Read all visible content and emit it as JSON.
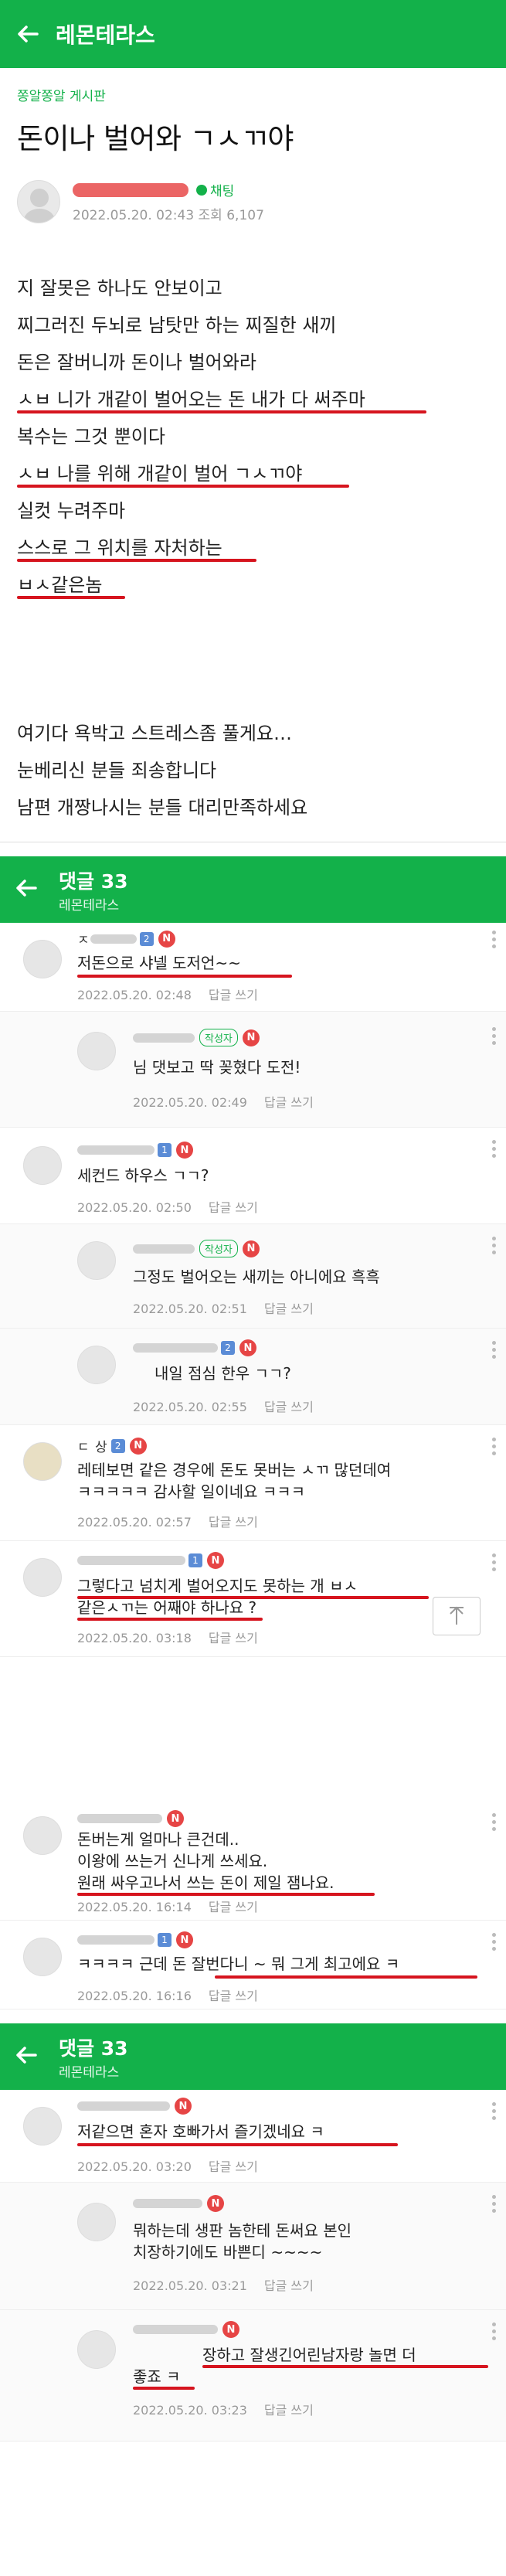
{
  "colors": {
    "brand_green": "#13b14a",
    "underline_red": "#d6141e",
    "new_badge": "#e64545"
  },
  "post": {
    "app_title": "레몬테라스",
    "board_link": "쫑알쫑알 게시판",
    "title": "돈이나 벌어와 ㄱㅅㄲ야",
    "chat_label": "채팅",
    "date": "2022.05.20. 02:43",
    "views": "조회 6,107",
    "lines": [
      "지 잘못은 하나도 안보이고",
      "찌그러진 두뇌로 남탓만 하는 찌질한 새끼",
      "돈은 잘버니까 돈이나 벌어와라",
      "ㅅㅂ 니가 개같이 벌어오는 돈 내가 다 써주마",
      "복수는 그것 뿐이다",
      "ㅅㅂ 나를 위해 개같이 벌어 ㄱㅅㄲ야",
      "실컷 누려주마",
      "스스로 그 위치를 자처하는",
      "ㅂㅅ같은놈",
      "",
      "",
      "",
      "여기다 욕박고 스트레스좀 풀게요…",
      "눈베리신 분들 죄송합니다",
      "남편 개짱나시는 분들 대리만족하세요"
    ]
  },
  "comment_header": {
    "title": "댓글 33",
    "subtitle": "레몬테라스"
  },
  "section1": [
    {
      "name": "ㅈ ",
      "text": [
        "저돈으로 샤넬 도저언~~"
      ],
      "date": "2022.05.20. 02:48",
      "reply": "답글 쓰기"
    },
    {
      "name": "",
      "writer": "작성자",
      "text": [
        "님 댓보고 딱 꽂혔다 도전!"
      ],
      "date": "2022.05.20. 02:49",
      "reply": "답글 쓰기"
    },
    {
      "name": "",
      "text": [
        "세컨드 하우스 ㄱㄱ?"
      ],
      "date": "2022.05.20. 02:50",
      "reply": "답글 쓰기"
    },
    {
      "name": "",
      "writer": "작성자",
      "text": [
        "그정도 벌어오는 새끼는 아니에요 흑흑"
      ],
      "date": "2022.05.20. 02:51",
      "reply": "답글 쓰기"
    },
    {
      "name": "",
      "text": [
        "내일 점심 한우 ㄱㄱ?"
      ],
      "date": "2022.05.20. 02:55",
      "reply": "답글 쓰기"
    },
    {
      "name": "ㄷ 상",
      "text": [
        "레테보면 같은 경우에 돈도 못버는 ㅅㄲ 많던데여",
        "ㅋㅋㅋㅋㅋ 감사할 일이네요 ㅋㅋㅋ"
      ],
      "date": "2022.05.20. 02:57",
      "reply": "답글 쓰기"
    },
    {
      "name": "",
      "text": [
        "그렇다고 넘치게 벌어오지도 못하는 개 ㅂㅅ",
        "같은ㅅㄲ는 어째야 하나요 ?"
      ],
      "date": "2022.05.20. 03:18",
      "reply": "답글 쓰기"
    }
  ],
  "section2": [
    {
      "name": "",
      "text": [
        "돈버는게 얼마나 큰건데..",
        "이왕에 쓰는거 신나게 쓰세요.",
        "원래 싸우고나서 쓰는 돈이 제일 잼나요."
      ],
      "date": "2022.05.20. 16:14",
      "reply": "답글 쓰기"
    },
    {
      "name": "",
      "text": [
        "ㅋㅋㅋㅋ 근데 돈 잘번다니 ~ 뭐 그게 최고에요 ㅋ"
      ],
      "date": "2022.05.20. 16:16",
      "reply": "답글 쓰기"
    }
  ],
  "section3": [
    {
      "name": "",
      "text": [
        "저같으면 혼자 호빠가서 즐기겠네요 ㅋ"
      ],
      "date": "2022.05.20. 03:20",
      "reply": "답글 쓰기"
    },
    {
      "name": "",
      "text": [
        "뭐하는데 생판 놈한테 돈써요 본인",
        "치장하기에도 바쁜디 ~~~~"
      ],
      "date": "2022.05.20. 03:21",
      "reply": "답글 쓰기"
    },
    {
      "name": "",
      "text": [
        "장하고 잘생긴어린남자랑 놀면 더",
        "좋죠 ㅋ"
      ],
      "date": "2022.05.20. 03:23",
      "reply": "답글 쓰기"
    }
  ]
}
